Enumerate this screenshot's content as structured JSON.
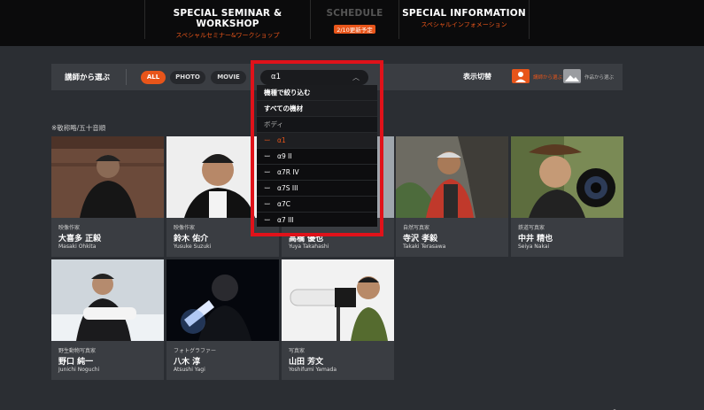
{
  "nav": [
    {
      "title": "SPECIAL SEMINAR & WORKSHOP",
      "subtitle": "スペシャルセミナー&ワークショップ"
    },
    {
      "title": "SCHEDULE",
      "badge": "2/10更新予定"
    },
    {
      "title": "SPECIAL INFORMATION",
      "subtitle": "スペシャルインフォメーション"
    }
  ],
  "filter": {
    "label": "講師から選ぶ",
    "tabs": [
      "ALL",
      "PHOTO",
      "MOVIE"
    ],
    "active_tab": "ALL",
    "select_value": "α1",
    "switch_label": "表示切替",
    "view_by_instructor": "講師から選ぶ",
    "view_by_work": "作品から選ぶ"
  },
  "note": "※敬称略/五十音順",
  "dropdown": {
    "items": [
      {
        "label": "機種で絞り込む",
        "kind": "bold"
      },
      {
        "label": "すべての機材",
        "kind": "bold"
      },
      {
        "label": "ボディ",
        "kind": "group"
      },
      {
        "label": "ー　α1",
        "kind": "selected"
      },
      {
        "label": "ー　α9 II",
        "kind": "option"
      },
      {
        "label": "ー　α7R IV",
        "kind": "option"
      },
      {
        "label": "ー　α7S III",
        "kind": "option"
      },
      {
        "label": "ー　α7C",
        "kind": "option"
      },
      {
        "label": "ー　α7 III",
        "kind": "option"
      }
    ]
  },
  "cards": [
    {
      "role": "映像作家",
      "name": "大喜多 正毅",
      "roman": "Masaki Ohkita"
    },
    {
      "role": "映像作家",
      "name": "鈴木 佑介",
      "roman": "Yusuke Suzuki"
    },
    {
      "role": "",
      "name": "高橋 優也",
      "roman": "Yuya Takahashi"
    },
    {
      "role": "自然写真家",
      "name": "寺沢 孝毅",
      "roman": "Takaki Terasawa"
    },
    {
      "role": "鉄道写真家",
      "name": "中井 精也",
      "roman": "Seiya Nakai"
    },
    {
      "role": "野生動物写真家",
      "name": "野口 純一",
      "roman": "Junichi Noguchi"
    },
    {
      "role": "フォトグラファー",
      "name": "八木 淳",
      "roman": "Atsushi Yagi"
    },
    {
      "role": "写真家",
      "name": "山田 芳文",
      "roman": "Yoshifumi Yamada"
    }
  ],
  "colors": {
    "accent": "#e8551a",
    "highlight": "#e0121a",
    "background": "#2b2e33"
  }
}
